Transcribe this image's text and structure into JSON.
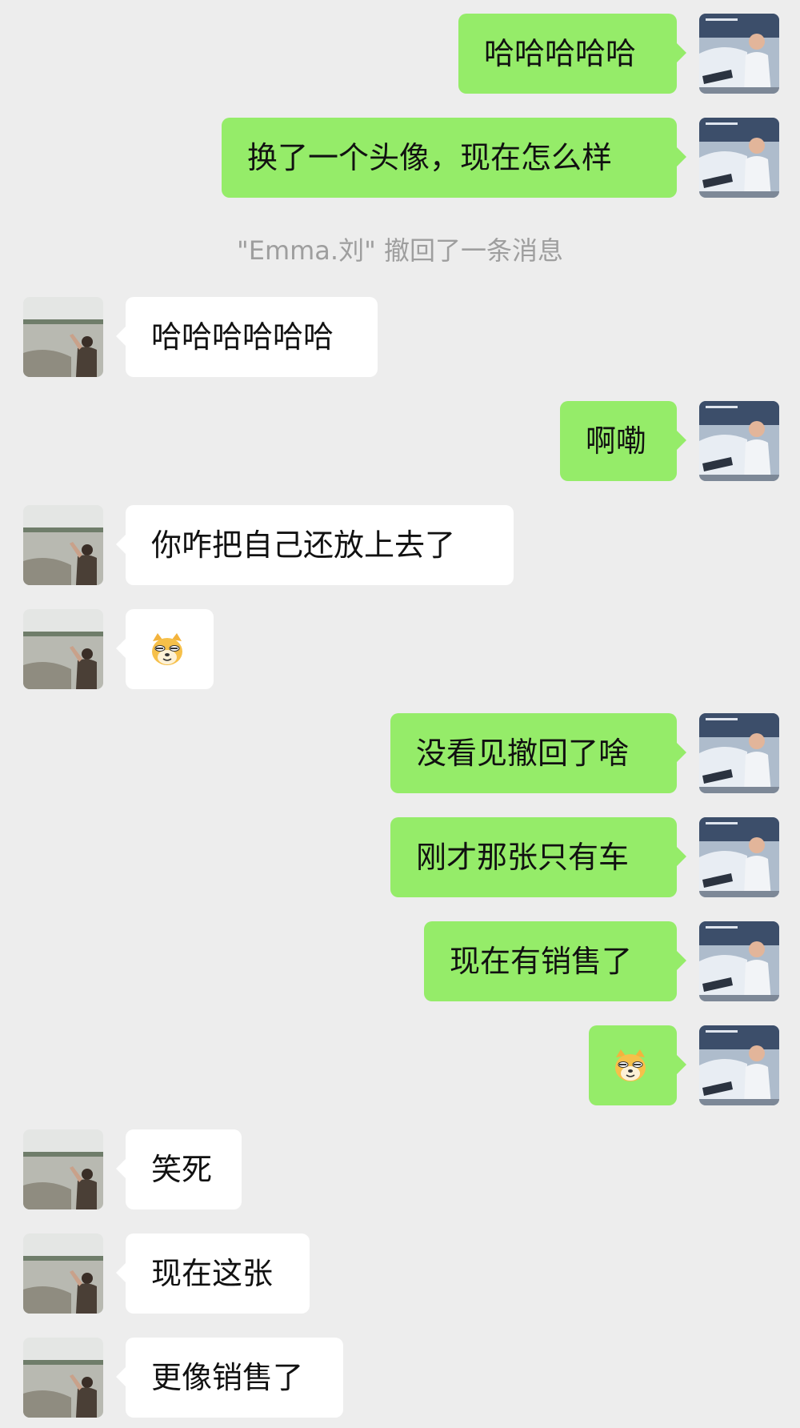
{
  "contacts": {
    "self": {
      "avatar_icon": "man-with-car-avatar"
    },
    "other": {
      "avatar_icon": "woman-by-lake-avatar"
    }
  },
  "messages": [
    {
      "from": "self",
      "text": "哈哈哈哈哈"
    },
    {
      "from": "self",
      "text": "换了一个头像，现在怎么样"
    },
    {
      "from": "system",
      "text": "\"Emma.刘\" 撤回了一条消息"
    },
    {
      "from": "other",
      "text": "哈哈哈哈哈哈"
    },
    {
      "from": "self",
      "text": "啊嘞"
    },
    {
      "from": "other",
      "text": "你咋把自己还放上去了"
    },
    {
      "from": "other",
      "emoji": "doge-emoji"
    },
    {
      "from": "self",
      "text": "没看见撤回了啥"
    },
    {
      "from": "self",
      "text": "刚才那张只有车"
    },
    {
      "from": "self",
      "text": "现在有销售了"
    },
    {
      "from": "self",
      "emoji": "doge-emoji"
    },
    {
      "from": "other",
      "text": "笑死"
    },
    {
      "from": "other",
      "text": "现在这张"
    },
    {
      "from": "other",
      "text": "更像销售了"
    }
  ],
  "colors": {
    "background": "#ededed",
    "self_bubble": "#95ec69",
    "other_bubble": "#ffffff",
    "system_text": "#9e9e9e"
  }
}
